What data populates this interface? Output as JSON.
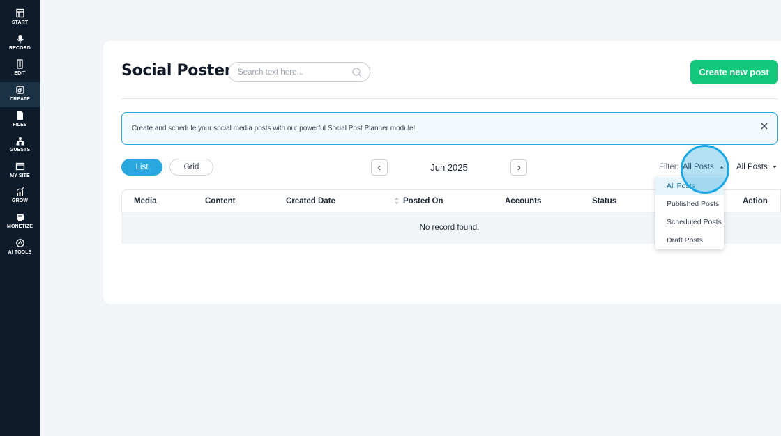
{
  "sidebar": {
    "items": [
      {
        "label": "START",
        "icon": "start-icon"
      },
      {
        "label": "RECORD",
        "icon": "microphone-icon"
      },
      {
        "label": "EDIT",
        "icon": "edit-icon"
      },
      {
        "label": "CREATE",
        "icon": "create-icon",
        "active": true
      },
      {
        "label": "FILES",
        "icon": "files-icon"
      },
      {
        "label": "GUESTS",
        "icon": "guests-icon"
      },
      {
        "label": "MY SITE",
        "icon": "site-icon"
      },
      {
        "label": "GROW",
        "icon": "grow-icon"
      },
      {
        "label": "MONETIZE",
        "icon": "monetize-icon"
      },
      {
        "label": "AI TOOLS",
        "icon": "ai-tools-icon"
      }
    ]
  },
  "header": {
    "title": "Social Poster",
    "search_placeholder": "Search text here...",
    "create_button": "Create new post"
  },
  "banner": {
    "text": "Create and schedule your social media posts with our powerful Social Post Planner module!"
  },
  "view_toggle": {
    "list": "List",
    "grid": "Grid",
    "active": "List"
  },
  "month_nav": {
    "label": "Jun 2025"
  },
  "filter": {
    "label": "Filter:",
    "value": "All Posts",
    "second_value": "All Posts",
    "options": [
      "All Posts",
      "Published Posts",
      "Scheduled Posts",
      "Draft Posts"
    ],
    "selected": "All Posts"
  },
  "table": {
    "columns": [
      "Media",
      "Content",
      "Created Date",
      "Posted On",
      "Accounts",
      "Status",
      "Action"
    ],
    "empty_message": "No record found."
  },
  "colors": {
    "sidebar_bg": "#0d1b2a",
    "accent_blue": "#29a8e0",
    "create_green": "#12c77a",
    "page_bg": "#f1f5f8"
  }
}
